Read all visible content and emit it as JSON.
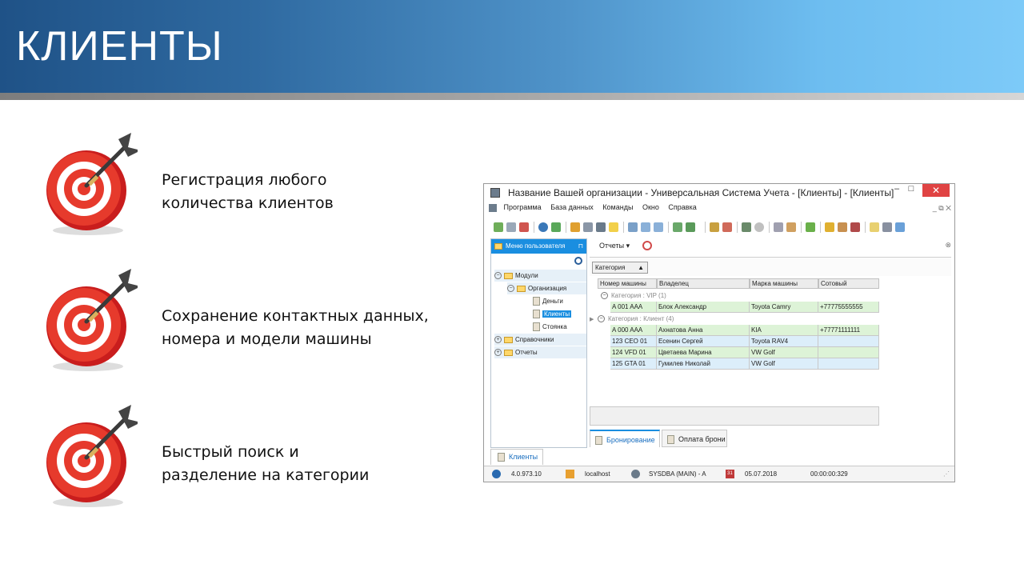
{
  "slide": {
    "title": "КЛИЕНТЫ",
    "bullets": [
      {
        "line1": "Регистрация любого",
        "line2": "количества клиентов"
      },
      {
        "line1": "Сохранение контактных данных,",
        "line2": "номера и модели машины"
      },
      {
        "line1": "Быстрый поиск и",
        "line2": "разделение на категории"
      }
    ]
  },
  "window": {
    "title": "Название Вашей организации - Универсальная Система Учета - [Клиенты] - [Клиенты]",
    "controls": {
      "minimize": "–",
      "maximize": "□",
      "close": "✕"
    },
    "menu": [
      "Программа",
      "База данных",
      "Команды",
      "Окно",
      "Справка"
    ],
    "menu_right": "_ ⧉ ✕"
  },
  "left_panel": {
    "header": "Меню пользователя",
    "pin": "⊓",
    "tree": [
      {
        "label": "Модули",
        "level": 0,
        "kind": "folder",
        "expander": "−"
      },
      {
        "label": "Организация",
        "level": 1,
        "kind": "folder",
        "expander": "−"
      },
      {
        "label": "Деньги",
        "level": 2,
        "kind": "doc"
      },
      {
        "label": "Клиенты",
        "level": 2,
        "kind": "doc",
        "selected": true
      },
      {
        "label": "Стоянка",
        "level": 2,
        "kind": "doc"
      },
      {
        "label": "Справочники",
        "level": 0,
        "kind": "folder",
        "expander": "+"
      },
      {
        "label": "Отчеты",
        "level": 0,
        "kind": "folder",
        "expander": "+"
      }
    ]
  },
  "right_panel": {
    "reports_label": "Отчеты ▾",
    "group_chip": "Категория",
    "group_chip_arrow": "▲",
    "columns": [
      "Номер машины",
      "Владелец",
      "Марка машины",
      "Сотовый"
    ],
    "groups": [
      {
        "label": "Категория : VIP (1)",
        "rows": [
          {
            "plate": "A 001 AAA",
            "owner": "Блок Александр",
            "brand": "Toyota Camry",
            "phone": "+77775555555",
            "tint": "green"
          }
        ]
      },
      {
        "label": "Категория : Клиент (4)",
        "rows": [
          {
            "plate": "A 000 AAA",
            "owner": "Ахнатова Анна",
            "brand": "KIA",
            "phone": "+77771111111",
            "tint": "green"
          },
          {
            "plate": "123 CEO 01",
            "owner": "Есенин Сергей",
            "brand": "Toyota RAV4",
            "phone": "",
            "tint": "blue"
          },
          {
            "plate": "124 VFD 01",
            "owner": "Цветаева Марина",
            "brand": "VW Golf",
            "phone": "",
            "tint": "green"
          },
          {
            "plate": "125 GTA 01",
            "owner": "Гумилев Николай",
            "brand": "VW Golf",
            "phone": "",
            "tint": "blue"
          }
        ]
      }
    ],
    "bottom_tabs": [
      "Бронирование",
      "Оплата брони"
    ]
  },
  "window_tab": "Клиенты",
  "status_bar": {
    "version": "4.0.973.10",
    "server": "localhost",
    "user": "SYSDBA (MAIN) - A",
    "calendar_icon_text": "31",
    "date": "05.07.2018",
    "timer": "00:00:00:329"
  },
  "colors": {
    "accent_blue": "#1a8ee0",
    "row_green": "#ddf3d7",
    "row_blue": "#dceefa",
    "close_red": "#e04343"
  }
}
